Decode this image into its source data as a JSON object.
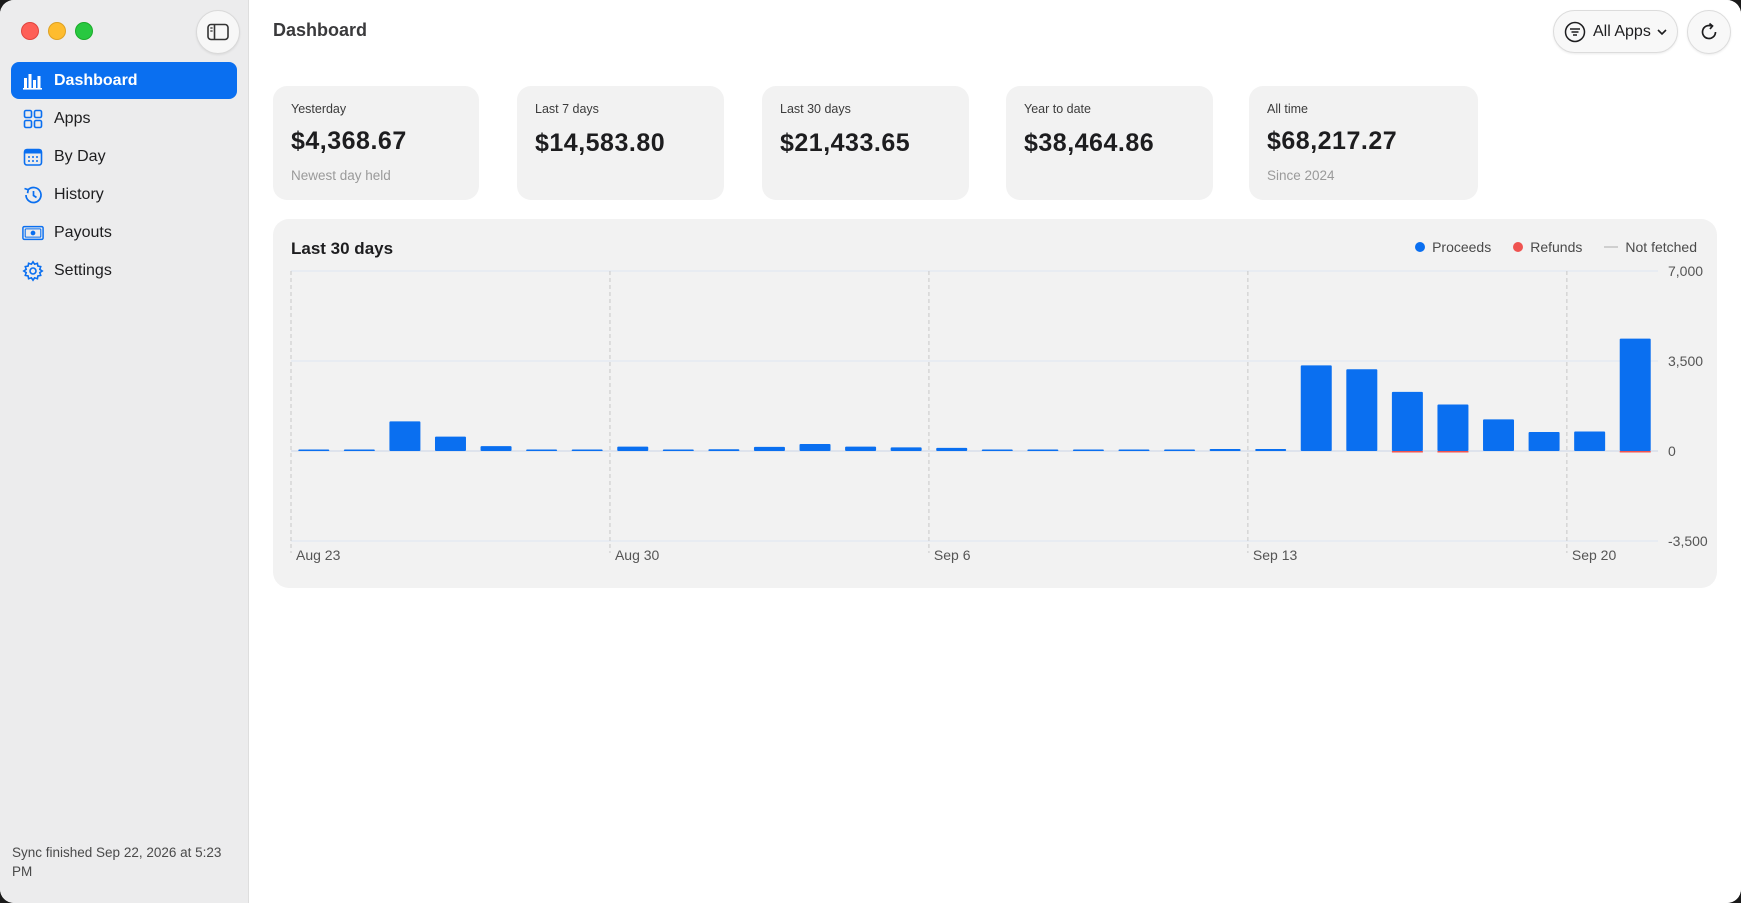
{
  "window": {
    "controls": [
      "close",
      "minimize",
      "zoom"
    ]
  },
  "sidebar": {
    "toggle_icon": "sidebar-toggle-icon",
    "items": [
      {
        "label": "Dashboard",
        "icon": "bar-chart-icon",
        "active": true
      },
      {
        "label": "Apps",
        "icon": "grid-icon",
        "active": false
      },
      {
        "label": "By Day",
        "icon": "calendar-icon",
        "active": false
      },
      {
        "label": "History",
        "icon": "clock-history-icon",
        "active": false
      },
      {
        "label": "Payouts",
        "icon": "banknote-icon",
        "active": false
      },
      {
        "label": "Settings",
        "icon": "gear-icon",
        "active": false
      }
    ],
    "sync_status": "Sync finished Sep 22, 2026 at 5:23 PM"
  },
  "header": {
    "title": "Dashboard",
    "app_filter": {
      "label": "All Apps",
      "icon": "filter-icon"
    },
    "refresh_icon": "refresh-icon"
  },
  "stats": [
    {
      "label": "Yesterday",
      "value": "$4,368.67",
      "sub": "Newest day held"
    },
    {
      "label": "Last 7 days",
      "value": "$14,583.80",
      "sub": ""
    },
    {
      "label": "Last 30 days",
      "value": "$21,433.65",
      "sub": ""
    },
    {
      "label": "Year to date",
      "value": "$38,464.86",
      "sub": ""
    },
    {
      "label": "All time",
      "value": "$68,217.27",
      "sub": "Since 2024"
    }
  ],
  "chart": {
    "title": "Last 30 days",
    "legend": [
      {
        "label": "Proceeds",
        "color": "#0a6ff0",
        "style": "dot"
      },
      {
        "label": "Refunds",
        "color": "#ef5350",
        "style": "dot"
      },
      {
        "label": "Not fetched",
        "color": "#cfcfcf",
        "style": "line"
      }
    ]
  },
  "chart_data": {
    "type": "bar",
    "title": "Last 30 days",
    "ylim": [
      -3500,
      7000
    ],
    "yticks": [
      7000,
      3500,
      0,
      -3500
    ],
    "ytick_labels": [
      "7,000",
      "3,500",
      "0",
      "-3,500"
    ],
    "xtick_labels": [
      "Aug 23",
      "Aug 30",
      "Sep 6",
      "Sep 13",
      "Sep 20"
    ],
    "xtick_indices": [
      0,
      7,
      14,
      21,
      28
    ],
    "categories": [
      "Aug 23",
      "Aug 24",
      "Aug 25",
      "Aug 26",
      "Aug 27",
      "Aug 28",
      "Aug 29",
      "Aug 30",
      "Aug 31",
      "Sep 1",
      "Sep 2",
      "Sep 3",
      "Sep 4",
      "Sep 5",
      "Sep 6",
      "Sep 7",
      "Sep 8",
      "Sep 9",
      "Sep 10",
      "Sep 11",
      "Sep 12",
      "Sep 13",
      "Sep 14",
      "Sep 15",
      "Sep 16",
      "Sep 17",
      "Sep 18",
      "Sep 19",
      "Sep 20",
      "Sep 21"
    ],
    "grid": true,
    "legend_position": "top-right",
    "series": [
      {
        "name": "Proceeds",
        "color": "#0a6ff0",
        "values": [
          20,
          40,
          1150,
          560,
          190,
          10,
          10,
          170,
          60,
          70,
          160,
          270,
          170,
          140,
          120,
          10,
          20,
          50,
          30,
          10,
          80,
          80,
          3330,
          3180,
          2300,
          1810,
          1230,
          740,
          760,
          4370
        ]
      },
      {
        "name": "Refunds",
        "color": "#ef5350",
        "values": [
          0,
          0,
          0,
          0,
          0,
          0,
          0,
          0,
          0,
          0,
          0,
          0,
          0,
          0,
          0,
          0,
          0,
          0,
          0,
          0,
          0,
          0,
          0,
          0,
          -20,
          -20,
          0,
          0,
          0,
          -30
        ]
      }
    ]
  }
}
